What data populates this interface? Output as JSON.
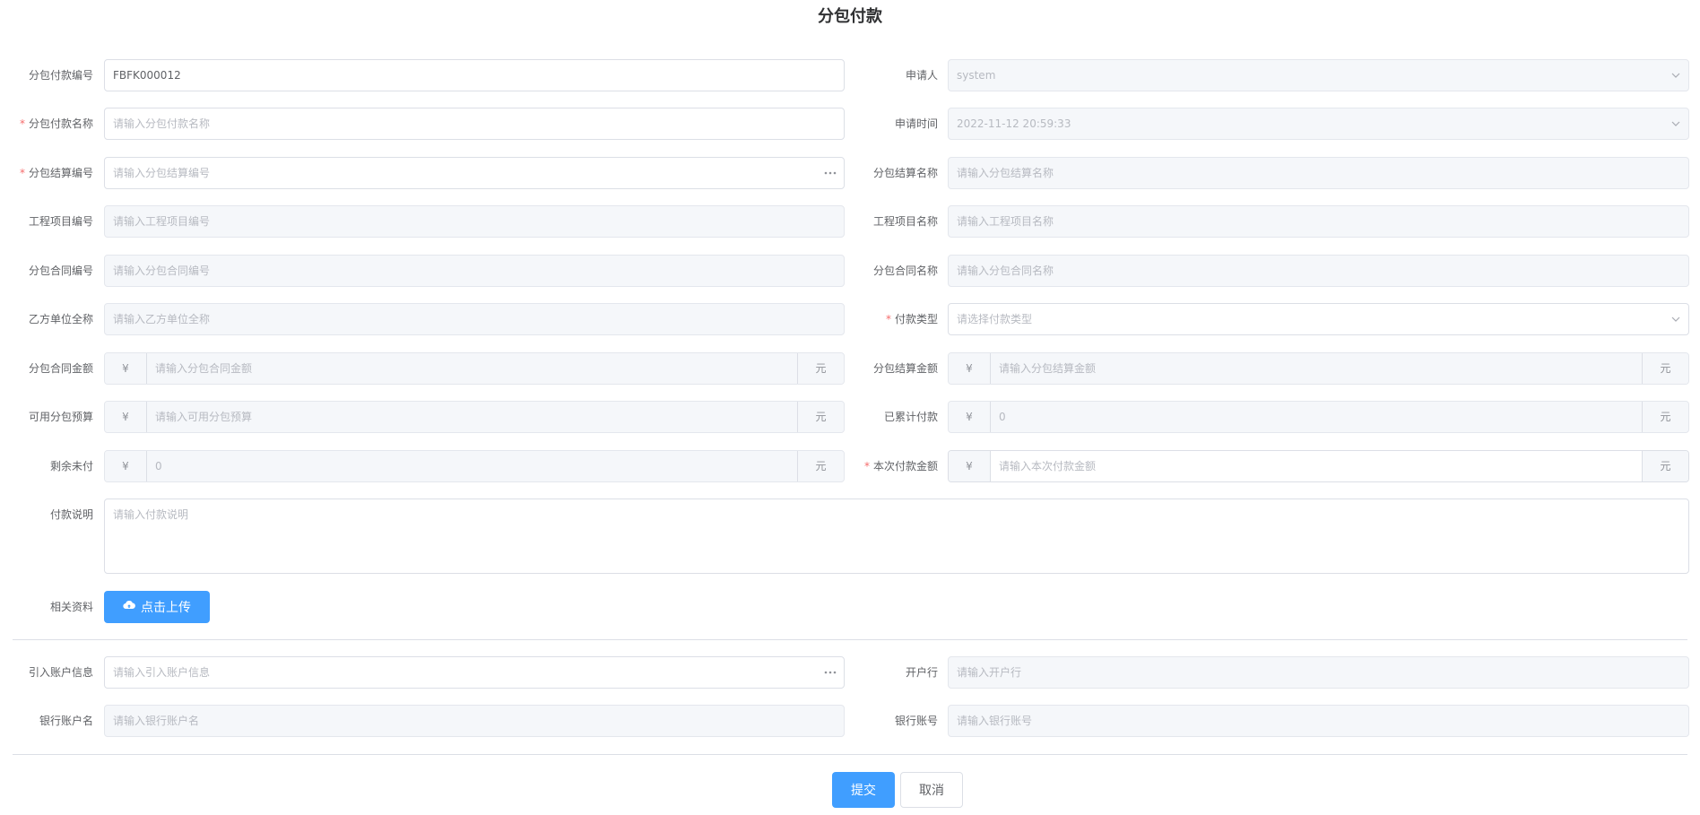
{
  "page": {
    "title": "分包付款"
  },
  "left": [
    {
      "label": "分包付款编号",
      "value": "FBFK000012",
      "required": false
    },
    {
      "label": "分包付款名称",
      "placeholder": "请输入分包付款名称",
      "required": true
    },
    {
      "label": "分包结算编号",
      "placeholder": "请输入分包结算编号",
      "required": true
    },
    {
      "label": "工程项目编号",
      "placeholder": "请输入工程项目编号"
    },
    {
      "label": "分包合同编号",
      "placeholder": "请输入分包合同编号"
    },
    {
      "label": "乙方单位全称",
      "placeholder": "请输入乙方单位全称"
    },
    {
      "label": "分包合同金额",
      "placeholder": "请输入分包合同金额"
    },
    {
      "label": "可用分包预算",
      "placeholder": "请输入可用分包预算"
    },
    {
      "label": "剩余未付",
      "value": "0"
    }
  ],
  "right": [
    {
      "label": "申请人",
      "value": "system"
    },
    {
      "label": "申请时间",
      "value": "2022-11-12 20:59:33"
    },
    {
      "label": "分包结算名称",
      "placeholder": "请输入分包结算名称"
    },
    {
      "label": "工程项目名称",
      "placeholder": "请输入工程项目名称"
    },
    {
      "label": "分包合同名称",
      "placeholder": "请输入分包合同名称"
    },
    {
      "label": "付款类型",
      "placeholder": "请选择付款类型",
      "required": true
    },
    {
      "label": "分包结算金额",
      "placeholder": "请输入分包结算金额"
    },
    {
      "label": "已累计付款",
      "value": "0"
    },
    {
      "label": "本次付款金额",
      "placeholder": "请输入本次付款金额",
      "required": true
    }
  ],
  "currency": {
    "prefix": "¥",
    "suffix": "元"
  },
  "payment_desc": {
    "label": "付款说明",
    "placeholder": "请输入付款说明"
  },
  "attachments": {
    "label": "相关资料",
    "button": "点击上传"
  },
  "account": [
    {
      "label": "引入账户信息",
      "placeholder": "请输入引入账户信息"
    },
    {
      "label": "开户行",
      "placeholder": "请输入开户行"
    },
    {
      "label": "银行账户名",
      "placeholder": "请输入银行账户名"
    },
    {
      "label": "银行账号",
      "placeholder": "请输入银行账号"
    }
  ],
  "actions": {
    "submit": "提交",
    "cancel": "取消"
  },
  "colors": {
    "primary": "#409eff",
    "required": "#f56c6c",
    "disabled_bg": "#f5f7fa"
  }
}
